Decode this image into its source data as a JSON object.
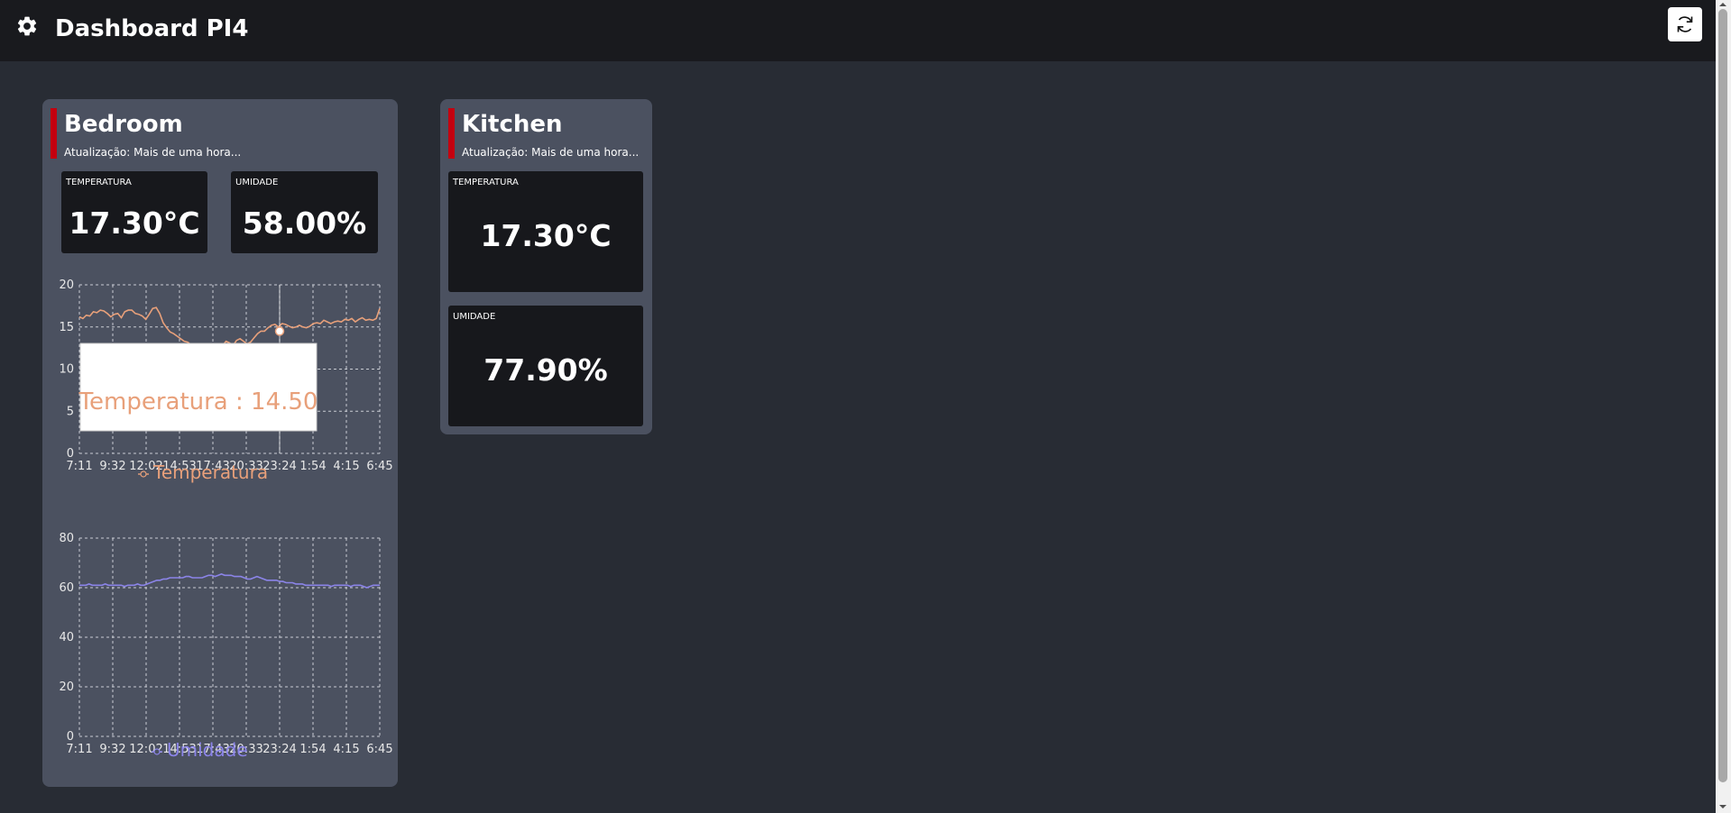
{
  "header": {
    "title": "Dashboard PI4",
    "settings_icon": "gear-icon",
    "refresh_icon": "refresh-icon"
  },
  "colors": {
    "background": "#282c34",
    "topbar": "#191a1e",
    "card": "#4b5160",
    "tile": "#17181c",
    "status_accent": "#c4000f",
    "temperature_series": "#e8a07a",
    "humidity_series": "#8b84e8"
  },
  "cards": [
    {
      "name": "Bedroom",
      "update_text": "Atualização: Mais de uma hora...",
      "temperature": {
        "label": "TEMPERATURA",
        "value": "17.30°C"
      },
      "humidity": {
        "label": "UMIDADE",
        "value": "58.00%"
      }
    },
    {
      "name": "Kitchen",
      "update_text": "Atualização: Mais de uma hora...",
      "temperature": {
        "label": "TEMPERATURA",
        "value": "17.30°C"
      },
      "humidity": {
        "label": "UMIDADE",
        "value": "77.90%"
      }
    }
  ],
  "chart_data": [
    {
      "type": "line",
      "x_ticks": [
        "7:11",
        "9:32",
        "12:02",
        "14:53",
        "17:43",
        "20:33",
        "23:24",
        "1:54",
        "4:15",
        "6:45"
      ],
      "y_ticks": [
        0,
        5,
        10,
        15,
        20
      ],
      "ylim": [
        0,
        20
      ],
      "grid": true,
      "legend_position": "bottom",
      "series": [
        {
          "name": "Temperatura",
          "color": "#e8a07a",
          "values": [
            16.2,
            16.0,
            16.4,
            16.3,
            16.8,
            16.7,
            17.0,
            16.9,
            16.6,
            16.2,
            16.5,
            16.6,
            16.1,
            16.8,
            17.0,
            17.0,
            16.6,
            16.5,
            16.3,
            15.9,
            16.5,
            17.2,
            17.3,
            16.6,
            15.5,
            14.9,
            14.4,
            14.2,
            13.9,
            13.6,
            13.3,
            13.2,
            12.9,
            12.6,
            12.5,
            12.3,
            12.4,
            12.2,
            12.0,
            11.9,
            12.3,
            12.8,
            13.3,
            13.1,
            12.8,
            13.4,
            13.6,
            13.3,
            13.0,
            13.2,
            13.7,
            14.2,
            14.5,
            14.5,
            14.9,
            15.2,
            15.3,
            15.0,
            15.4,
            15.3,
            15.1,
            14.9,
            15.0,
            15.2,
            15.0,
            14.9,
            15.1,
            15.4,
            15.5,
            15.4,
            15.8,
            15.6,
            15.4,
            15.6,
            15.7,
            15.6,
            15.9,
            15.8,
            16.0,
            15.6,
            15.9,
            16.1,
            15.8,
            15.9,
            15.8,
            16.0,
            17.2
          ]
        }
      ],
      "tooltip": {
        "text": "Temperatura : 14.50",
        "x": "23:24",
        "value": 14.5
      }
    },
    {
      "type": "line",
      "x_ticks": [
        "7:11",
        "9:32",
        "12:02",
        "14:53",
        "17:43",
        "20:33",
        "23:24",
        "1:54",
        "4:15",
        "6:45"
      ],
      "y_ticks": [
        0,
        20,
        40,
        60,
        80
      ],
      "ylim": [
        0,
        80
      ],
      "grid": true,
      "legend_position": "bottom",
      "series": [
        {
          "name": "Umidade",
          "color": "#8b84e8",
          "values": [
            61,
            61,
            61,
            61.5,
            61,
            61,
            61,
            61,
            61.5,
            61,
            61,
            61,
            61,
            61,
            60.5,
            61,
            61,
            61,
            61.5,
            61,
            61,
            61.5,
            62,
            62.5,
            63,
            63,
            63.5,
            63.5,
            64,
            64,
            64,
            64,
            64,
            64.5,
            64.5,
            64,
            64,
            64,
            64,
            64.5,
            65,
            65,
            64.5,
            65,
            65.5,
            65,
            65,
            65,
            64.5,
            64.5,
            64.5,
            64,
            63.5,
            63.5,
            64,
            64.5,
            64,
            63.5,
            63,
            63,
            63,
            63,
            62.5,
            62.5,
            62,
            62,
            62,
            61.5,
            61.5,
            61.5,
            61,
            61,
            61,
            61,
            61,
            61,
            61,
            61,
            60.5,
            61,
            61,
            61,
            61,
            61,
            60.5,
            61,
            61,
            61,
            60.5,
            60,
            60.5,
            61,
            61,
            61
          ]
        }
      ]
    }
  ]
}
